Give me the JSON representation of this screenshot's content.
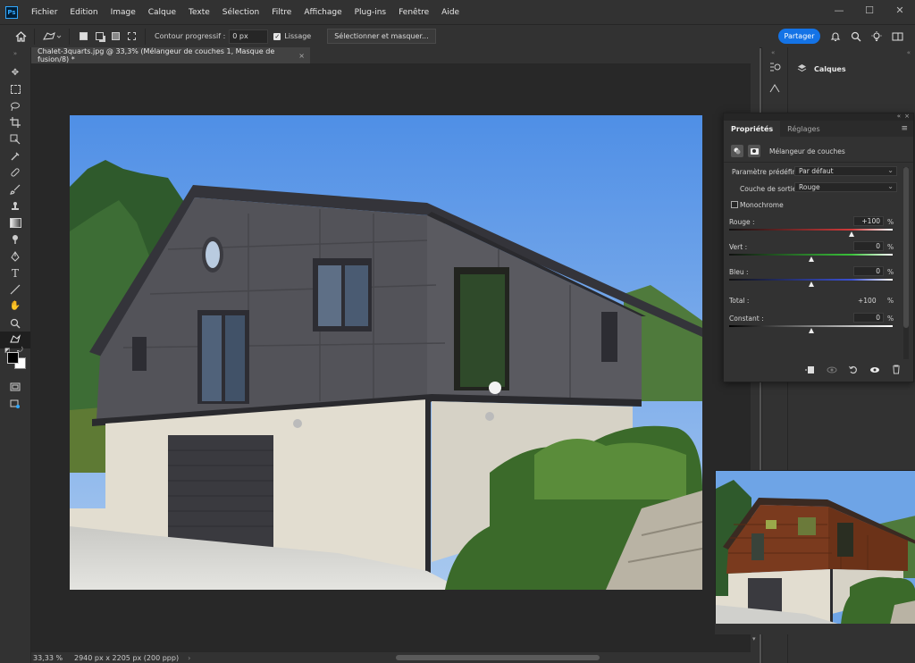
{
  "menubar": {
    "app_badge": "Ps",
    "items": [
      "Fichier",
      "Edition",
      "Image",
      "Calque",
      "Texte",
      "Sélection",
      "Filtre",
      "Affichage",
      "Plug-ins",
      "Fenêtre",
      "Aide"
    ],
    "window_controls": [
      "—",
      "☐",
      "✕"
    ]
  },
  "options": {
    "feather_label": "Contour progressif :",
    "feather_value": "0 px",
    "smoothing_label": "Lissage",
    "select_mask_label": "Sélectionner et masquer...",
    "share_label": "Partager"
  },
  "document": {
    "tab_title": "Chalet-3quarts.jpg @ 33,3% (Mélangeur de couches 1, Masque de fusion/8) *",
    "tab_close": "×",
    "zoom": "33,33 %",
    "dimensions": "2940 px x 2205 px (200 ppp)"
  },
  "layers": {
    "title": "Calques"
  },
  "properties": {
    "tabs": [
      "Propriétés",
      "Réglages"
    ],
    "adjustment_name": "Mélangeur de couches",
    "preset_label": "Paramètre prédéfini :",
    "preset_value": "Par défaut",
    "output_label": "Couche de sortie :",
    "output_value": "Rouge",
    "monochrome_label": "Monochrome",
    "channels": [
      {
        "label": "Rouge :",
        "value": "+100",
        "fraction": 0.75,
        "color": "#d23a3a"
      },
      {
        "label": "Vert :",
        "value": "0",
        "fraction": 0.5,
        "color": "#3ac23a"
      },
      {
        "label": "Bleu :",
        "value": "0",
        "fraction": 0.5,
        "color": "#3a50d2"
      }
    ],
    "total_label": "Total :",
    "total_value": "+100",
    "constant_label": "Constant :",
    "constant_value": "0",
    "constant_fraction": 0.5,
    "percent": "%"
  },
  "colors": {
    "accent": "#1473e6",
    "panel": "#323232",
    "canvas": "#282828"
  },
  "icons": [
    "home-icon",
    "lasso-tool-icon",
    "new-selection-icon",
    "add-selection-icon",
    "subtract-selection-icon",
    "intersect-selection-icon",
    "bell-icon",
    "search-icon",
    "lightbulb-icon",
    "workspace-icon",
    "layers-icon",
    "mask-icon",
    "eye-icon",
    "trash-icon"
  ]
}
